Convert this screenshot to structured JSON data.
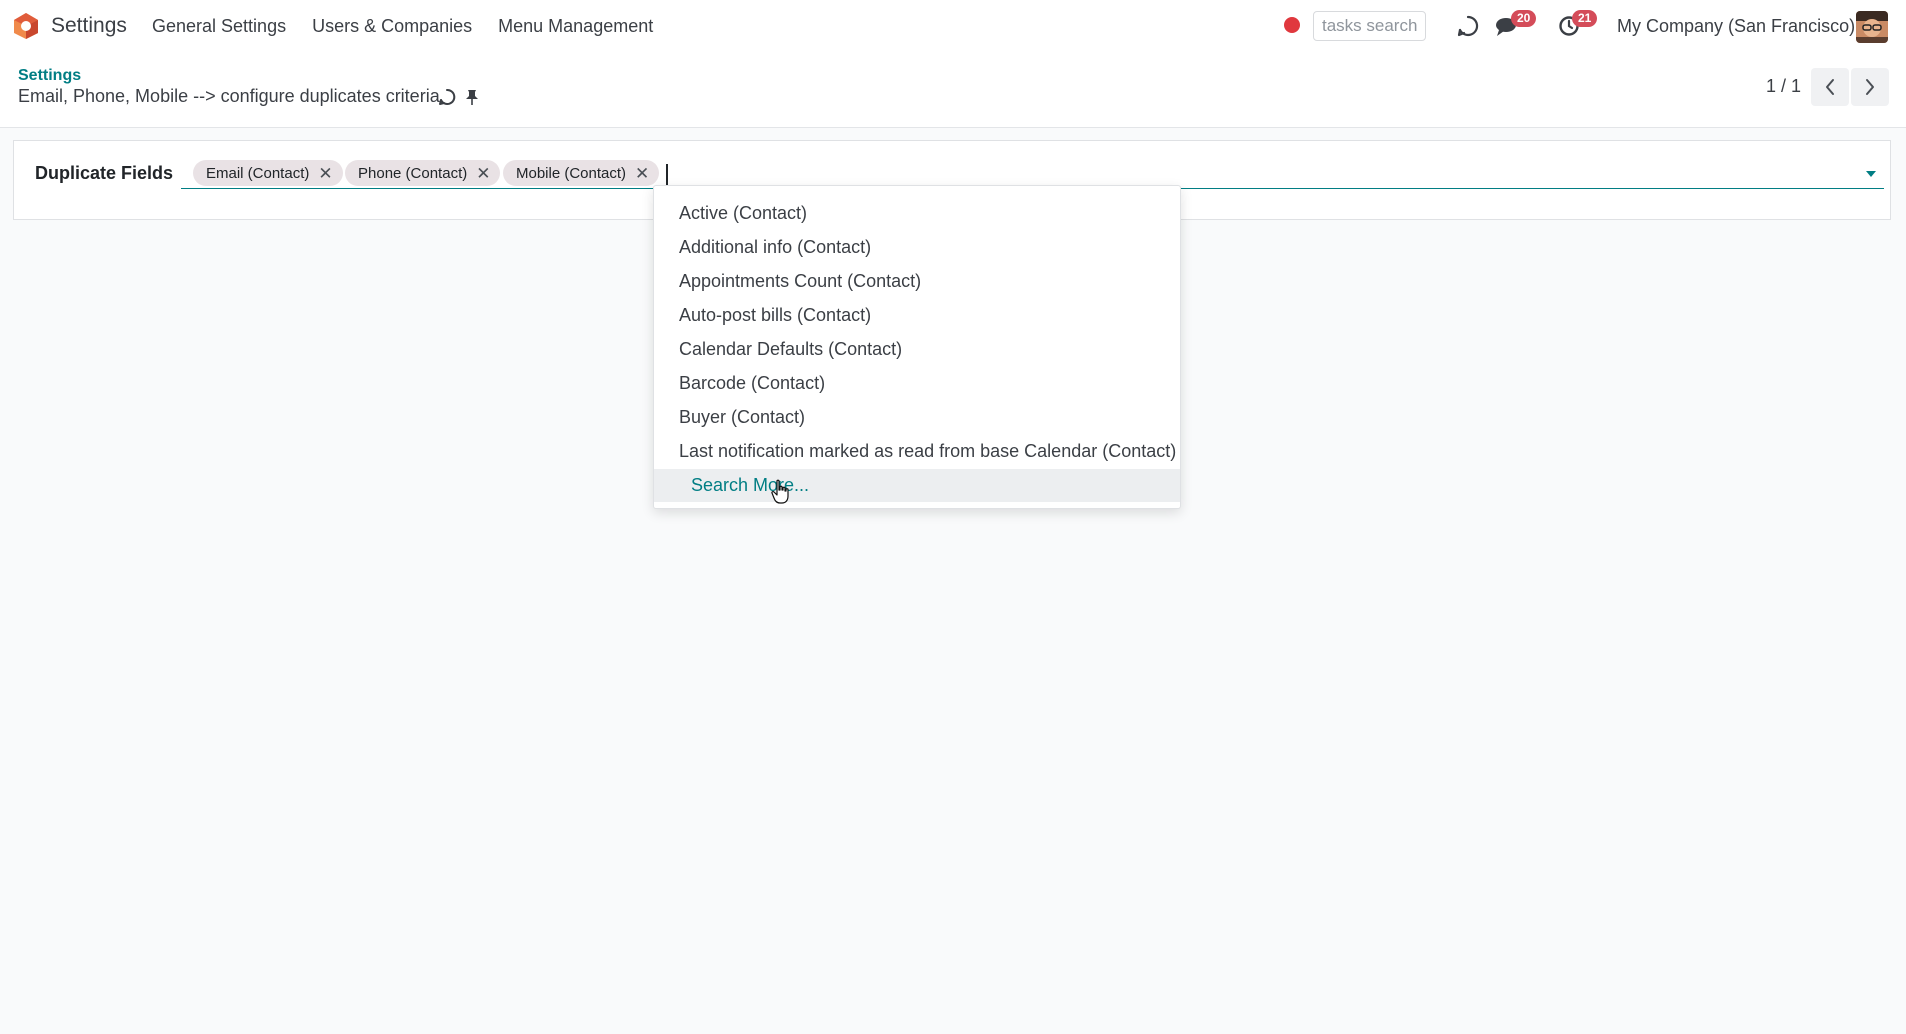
{
  "navbar": {
    "app_name": "Settings",
    "menu": [
      "General Settings",
      "Users & Companies",
      "Menu Management"
    ],
    "tasks_search_placeholder": "tasks search",
    "messages_badge": "20",
    "activities_badge": "21",
    "company": "My Company (San Francisco)"
  },
  "control_panel": {
    "breadcrumb": "Settings",
    "record_title": "Email, Phone, Mobile --> configure duplicates criteria",
    "pager": "1 / 1"
  },
  "form": {
    "field_label": "Duplicate Fields",
    "tags": [
      "Email (Contact)",
      "Phone (Contact)",
      "Mobile (Contact)"
    ]
  },
  "dropdown": {
    "items": [
      "Active (Contact)",
      "Additional info (Contact)",
      "Appointments Count (Contact)",
      "Auto-post bills (Contact)",
      "Calendar Defaults (Contact)",
      "Barcode (Contact)",
      "Buyer (Contact)",
      "Last notification marked as read from base Calendar (Contact)"
    ],
    "search_more": "Search More..."
  },
  "colors": {
    "brand": "#017e84",
    "badge": "#d44c59",
    "record_dot": "#e0383e",
    "tag_bg": "#e9e2e5"
  },
  "icons": [
    "odoo-logo-icon",
    "discuss-refresh-icon",
    "chat-icon",
    "activity-clock-icon",
    "gear-icon",
    "pin-icon",
    "chevron-left-icon",
    "chevron-right-icon",
    "close-icon",
    "caret-down-icon",
    "pointer-hand-icon"
  ]
}
